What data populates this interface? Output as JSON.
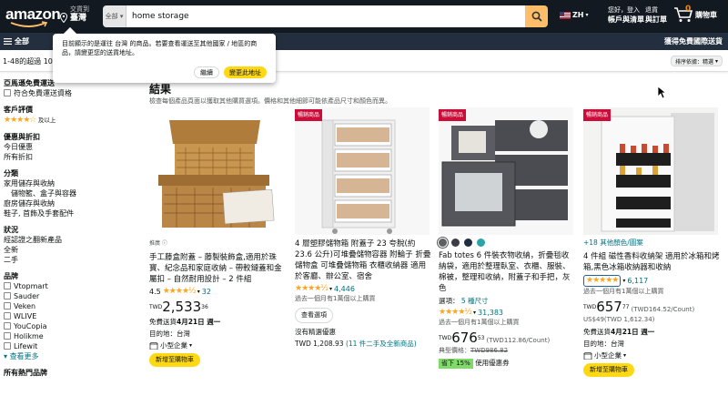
{
  "header": {
    "logo": "amazon",
    "deliver_line1": "交貨到",
    "deliver_line2": "臺灣",
    "search_category": "全部",
    "search_value": "home storage",
    "lang": "ZH",
    "account_line1": "您好，登入",
    "account_line2": "帳戶與清單",
    "returns_line1": "退貨",
    "returns_line2": "與訂單",
    "cart_count": "0",
    "cart_label": "購物車"
  },
  "nav": {
    "all": "全部",
    "right": "獲得免費國際送貨"
  },
  "results_bar": {
    "text": "1-48的超過 100,",
    "sort": "排序依據：精選"
  },
  "popover": {
    "message": "目前顯示的是運往 台灣 的商品。若要查看運送至其他國家 / 地區的商品，請變更您的送貨地址。",
    "continue": "繼續",
    "change": "變更此地址"
  },
  "sidebar": {
    "free_ship_h": "亞馬遜免費運送",
    "free_ship_item": "符合免費運送資格",
    "review_h": "客戶評價",
    "review_stars": "★★★★☆",
    "review_up": "及以上",
    "deals_h": "優惠與折扣",
    "deals": [
      "今日優惠",
      "所有折扣"
    ],
    "cat_h": "分類",
    "cats": [
      "家用儲存與收納",
      "儲物籃、盒子與容器",
      "廚房儲存與收納",
      "鞋子, 首飾及手套配件"
    ],
    "cond_h": "狀況",
    "conds": [
      "經認證之翻新產品",
      "全新",
      "二手"
    ],
    "brand_h": "品牌",
    "brands": [
      "Vtopmart",
      "Sauder",
      "Veken",
      "WLIVE",
      "YouCopia",
      "Holikme",
      "Lifewit"
    ],
    "see_more": "查看更多",
    "popular_h": "所有熱門品牌"
  },
  "main": {
    "heading": "結果",
    "subheading": "檢查每個產品頁面以獲取其他購買選項。價格和其他細節可能依產品尺寸和顏色而異。"
  },
  "products": [
    {
      "badge": "",
      "sponsor": "推廣 ⓘ",
      "title": "手工藤盒附蓋 – 藤製裝飾盒,適用於珠寶、紀念品和家庭收納 – 帶較鏈蓋和金屬扣 – 自然耐用設計 – 2 件組",
      "rating_value": "4.5",
      "stars": "★★★★½",
      "rating_count": "32",
      "price_cur": "TWD",
      "price_whole": "2,533",
      "price_frac": "36",
      "ship": "免費送貨",
      "ship_date": "4月21日 週一",
      "dest": "目的地：台灣",
      "biz": "小型企業",
      "action": "新增至購物車"
    },
    {
      "badge": "暢銷商品",
      "title": "4 層塑膠儲物箱 附蓋子 23 夸脫(約 23.6 公升)可堆疊儲物容器 附輪子 折疊儲物盒 可堆疊儲物箱 衣櫃收納器 適用於客廳、辦公室、宿舍",
      "stars": "★★★★½",
      "rating_count": "4,446",
      "sold": "過去一個月有1萬個以上購買",
      "action": "查看選項",
      "no_offer": "沒有精選優惠",
      "alt_price": "TWD 1,208.93",
      "alt_link": "(11 件二手及全新商品)"
    },
    {
      "badge": "暢銷商品",
      "title": "Fab totes 6 件裝衣物收納，折疊毯收納袋，適用於整理臥室、衣櫃、服裝、棉被，整理和收納，附蓋子和手把，灰色",
      "option": "選項：",
      "option_link": "5 種尺寸",
      "stars": "★★★★½",
      "rating_count": "31,383",
      "sold": "過去一個月有1萬個以上購買",
      "price_cur": "TWD",
      "price_whole": "676",
      "price_frac": "53",
      "unit": "(TWD112.86/Count)",
      "typical": "典型價格：",
      "typical_price": "TWD986.82",
      "save": "省下 15%",
      "coupon": "使用優惠券",
      "swatch_colors": [
        "#5d5f63",
        "#3b3d42",
        "#1f2d40",
        "#2aa4a8"
      ]
    },
    {
      "badge": "暢銷商品",
      "more_colors": "+18 其他顏色/圖案",
      "title": "4 件組 磁性香料收納架 適用於冰箱和烤箱,黑色冰箱收納器和收納",
      "stars": "★★★★★",
      "rating_count": "6,117",
      "sold": "過去一個月有1萬個以上購買",
      "price_cur": "TWD",
      "price_whole": "657",
      "price_frac": "77",
      "unit": "(TWD164.52/Count)",
      "alt_price": "US$49(TWD 1,612.34)",
      "ship": "免費送貨",
      "ship_date": "4月21日 週一",
      "dest": "目的地：台灣",
      "biz": "小型企業",
      "action": "新增至購物車"
    }
  ]
}
